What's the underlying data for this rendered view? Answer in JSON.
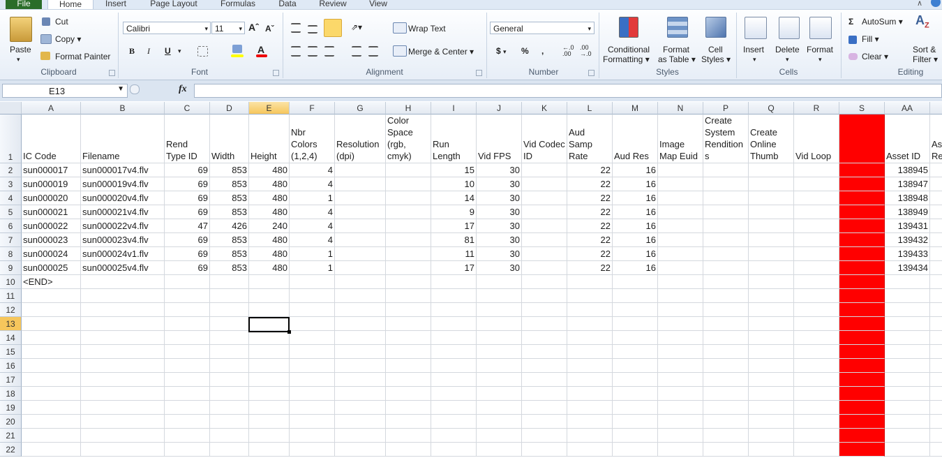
{
  "tabs": [
    {
      "id": "file",
      "label": "File"
    },
    {
      "id": "home",
      "label": "Home"
    },
    {
      "id": "insert",
      "label": "Insert"
    },
    {
      "id": "pagelayout",
      "label": "Page Layout"
    },
    {
      "id": "formulas",
      "label": "Formulas"
    },
    {
      "id": "data",
      "label": "Data"
    },
    {
      "id": "review",
      "label": "Review"
    },
    {
      "id": "view",
      "label": "View"
    }
  ],
  "ribbon": {
    "clipboard": {
      "title": "Clipboard",
      "paste": "Paste",
      "cut": "Cut",
      "copy": "Copy",
      "format_painter": "Format Painter"
    },
    "font": {
      "title": "Font",
      "name": "Calibri",
      "size": "11",
      "bold": "B",
      "italic": "I",
      "underline": "U"
    },
    "alignment": {
      "title": "Alignment",
      "wrap": "Wrap Text",
      "merge": "Merge & Center"
    },
    "number": {
      "title": "Number",
      "format": "General",
      "currency": "$",
      "percent": "%",
      "comma": ","
    },
    "styles": {
      "title": "Styles",
      "conditional": "Conditional",
      "conditional2": "Formatting",
      "format_table": "Format",
      "format_table2": "as Table",
      "cell_styles": "Cell",
      "cell_styles2": "Styles"
    },
    "cells": {
      "title": "Cells",
      "insert": "Insert",
      "delete": "Delete",
      "format": "Format"
    },
    "editing": {
      "title": "Editing",
      "autosum": "AutoSum",
      "fill": "Fill",
      "clear": "Clear",
      "sort": "Sort &",
      "filter": "Filter"
    }
  },
  "formula_bar": {
    "name_box": "E13",
    "fx": "fx",
    "value": ""
  },
  "columns": [
    "A",
    "B",
    "C",
    "D",
    "E",
    "F",
    "G",
    "H",
    "I",
    "J",
    "K",
    "L",
    "M",
    "N",
    "P",
    "Q",
    "R",
    "S",
    "AA"
  ],
  "rows": [
    "1",
    "2",
    "3",
    "4",
    "5",
    "6",
    "7",
    "8",
    "9",
    "10",
    "11",
    "12",
    "13",
    "14",
    "15",
    "16",
    "17",
    "18",
    "19",
    "20",
    "21",
    "22"
  ],
  "headers": [
    "IC Code",
    "Filename",
    "Rend Type ID",
    "Width",
    "Height",
    "Nbr Colors (1,2,4)",
    "Resolution (dpi)",
    "Color Space (rgb, cmyk)",
    "Run Length",
    "Vid FPS",
    "Vid Codec ID",
    "Aud Samp Rate",
    "Aud Res",
    "Image Map Euid",
    "Create System Rendition s",
    "Create Online Thumb",
    "Vid Loop",
    "",
    "Asset ID",
    "As Re"
  ],
  "data_rows": [
    [
      "sun000017",
      "sun000017v4.flv",
      "69",
      "853",
      "480",
      "4",
      "",
      "",
      "15",
      "30",
      "",
      "22",
      "16",
      "",
      "",
      "",
      "",
      "",
      "138945"
    ],
    [
      "sun000019",
      "sun000019v4.flv",
      "69",
      "853",
      "480",
      "4",
      "",
      "",
      "10",
      "30",
      "",
      "22",
      "16",
      "",
      "",
      "",
      "",
      "",
      "138947"
    ],
    [
      "sun000020",
      "sun000020v4.flv",
      "69",
      "853",
      "480",
      "1",
      "",
      "",
      "14",
      "30",
      "",
      "22",
      "16",
      "",
      "",
      "",
      "",
      "",
      "138948"
    ],
    [
      "sun000021",
      "sun000021v4.flv",
      "69",
      "853",
      "480",
      "4",
      "",
      "",
      "9",
      "30",
      "",
      "22",
      "16",
      "",
      "",
      "",
      "",
      "",
      "138949"
    ],
    [
      "sun000022",
      "sun000022v4.flv",
      "47",
      "426",
      "240",
      "4",
      "",
      "",
      "17",
      "30",
      "",
      "22",
      "16",
      "",
      "",
      "",
      "",
      "",
      "139431"
    ],
    [
      "sun000023",
      "sun000023v4.flv",
      "69",
      "853",
      "480",
      "4",
      "",
      "",
      "81",
      "30",
      "",
      "22",
      "16",
      "",
      "",
      "",
      "",
      "",
      "139432"
    ],
    [
      "sun000024",
      "sun000024v1.flv",
      "69",
      "853",
      "480",
      "1",
      "",
      "",
      "11",
      "30",
      "",
      "22",
      "16",
      "",
      "",
      "",
      "",
      "",
      "139433"
    ],
    [
      "sun000025",
      "sun000025v4.flv",
      "69",
      "853",
      "480",
      "1",
      "",
      "",
      "17",
      "30",
      "",
      "22",
      "16",
      "",
      "",
      "",
      "",
      "",
      "139434"
    ]
  ],
  "end_marker": "<END>",
  "colors": {
    "accent_file_tab": "#2a6d29",
    "highlight_column": "#ff0000",
    "selected_header": "#f6c65c"
  }
}
